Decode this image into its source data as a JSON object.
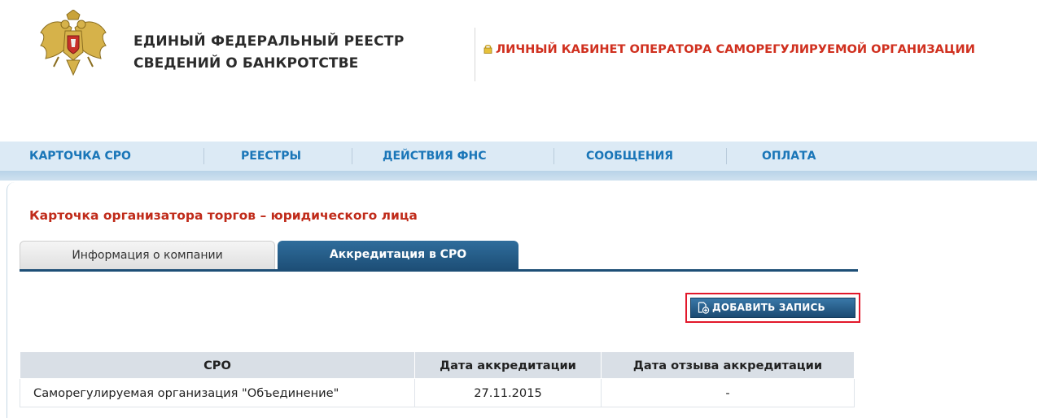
{
  "header": {
    "title_line1": "ЕДИНЫЙ ФЕДЕРАЛЬНЫЙ РЕЕСТР",
    "title_line2": "СВЕДЕНИЙ О БАНКРОТСТВЕ",
    "cabinet_label": "ЛИЧНЫЙ КАБИНЕТ ОПЕРАТОРА САМОРЕГУЛИРУЕМОЙ ОРГАНИЗАЦИИ",
    "cabinet_color": "#d0301f"
  },
  "nav": {
    "items": [
      {
        "label": "КАРТОЧКА СРО"
      },
      {
        "label": "РЕЕСТРЫ"
      },
      {
        "label": "ДЕЙСТВИЯ ФНС"
      },
      {
        "label": "СООБЩЕНИЯ"
      },
      {
        "label": "ОПЛАТА"
      }
    ],
    "color": "#1a76b8"
  },
  "page": {
    "title": "Карточка организатора торгов – юридического лица"
  },
  "tabs": [
    {
      "label": "Информация о компании",
      "active": false
    },
    {
      "label": "Аккредитация в СРО",
      "active": true
    }
  ],
  "toolbar": {
    "add_label": "ДОБАВИТЬ ЗАПИСЬ"
  },
  "table": {
    "headers": [
      "СРО",
      "Дата аккредитации",
      "Дата отзыва аккредитации"
    ],
    "rows": [
      [
        "Саморегулируемая организация \"Объединение\"",
        "27.11.2015",
        "-"
      ]
    ]
  }
}
